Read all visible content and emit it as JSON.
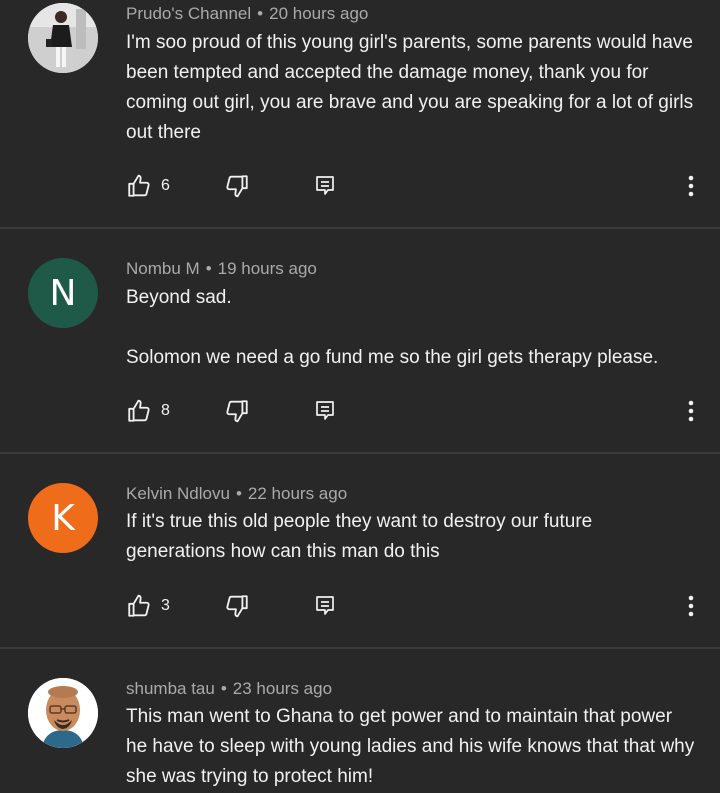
{
  "comments": [
    {
      "author": "Prudo's Channel",
      "separator": "•",
      "time": "20 hours ago",
      "text": [
        "I'm soo proud of this young girl's parents, some parents would have been tempted and accepted the damage money, thank you for coming out girl, you are brave and you are speaking for a lot of girls out  there"
      ],
      "likes": "6",
      "avatar": {
        "type": "photo-person"
      }
    },
    {
      "author": "Nombu M",
      "separator": "•",
      "time": "19 hours ago",
      "text": [
        "Beyond sad.",
        "Solomon we need a go fund me so the girl gets therapy please."
      ],
      "likes": "8",
      "avatar": {
        "type": "letter",
        "letter": "N",
        "color": "#1e5a47"
      }
    },
    {
      "author": "Kelvin Ndlovu",
      "separator": "•",
      "time": "22 hours ago",
      "text": [
        "If it's true this old people they want to destroy our future generations how can this man do this"
      ],
      "likes": "3",
      "avatar": {
        "type": "letter",
        "letter": "K",
        "color": "#ef6c1a"
      }
    },
    {
      "author": "shumba tau",
      "separator": "•",
      "time": "23 hours ago",
      "text": [
        "This man went to Ghana to get power and to maintain that power he have to sleep with young ladies and his wife knows that that why she was trying to protect him!"
      ],
      "likes": "",
      "avatar": {
        "type": "cartoon-man"
      }
    }
  ],
  "icons": {
    "like": "thumbs-up-icon",
    "dislike": "thumbs-down-icon",
    "reply": "reply-icon",
    "more": "more-vert-icon"
  },
  "colors": {
    "background": "#282828",
    "text": "#f1f1f1",
    "meta": "#aaaaaa",
    "divider": "#3a3a3a"
  }
}
